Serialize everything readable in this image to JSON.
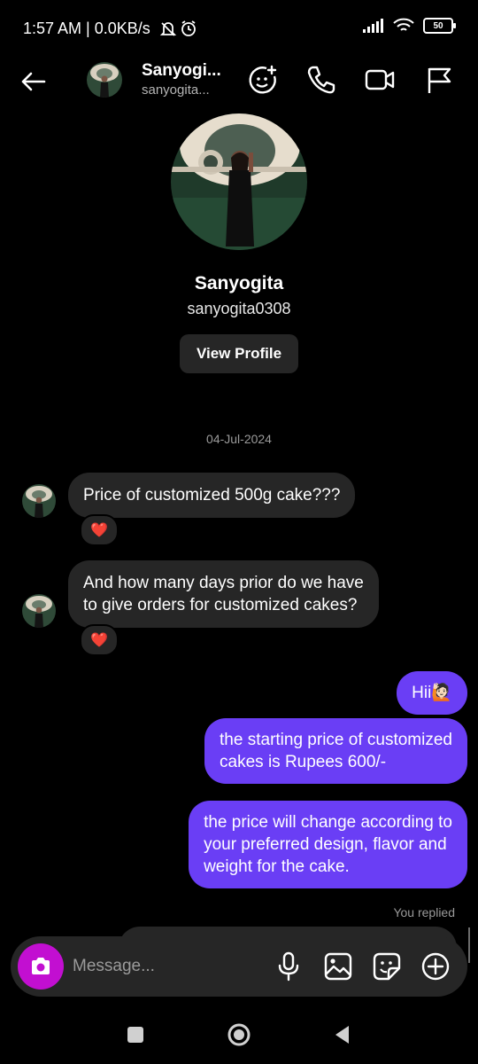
{
  "status_bar": {
    "time": "1:57 AM | 0.0KB/s",
    "battery": "50"
  },
  "header": {
    "name": "Sanyogi...",
    "username": "sanyogita..."
  },
  "profile": {
    "name": "Sanyogita",
    "username": "sanyogita0308",
    "view_profile_label": "View Profile"
  },
  "conversation": {
    "date": "04-Jul-2024",
    "incoming": [
      {
        "text": "Price of customized 500g cake???",
        "reaction": "❤️"
      },
      {
        "line1": "And how many days prior do we have",
        "line2": "to give orders for customized cakes?",
        "reaction": "❤️"
      }
    ],
    "outgoing": [
      {
        "text": "Hii🙋🏻"
      },
      {
        "line1": "the starting price of customized",
        "line2": "cakes is Rupees 600/-"
      },
      {
        "line1": "the price will change according to",
        "line2": "your preferred design, flavor and",
        "line3": "weight for the cake."
      }
    ],
    "you_replied": "You replied"
  },
  "composer": {
    "placeholder": "Message..."
  },
  "colors": {
    "background": "#000000",
    "incoming_bubble": "#262626",
    "outgoing_bubble": "#6a3ef5",
    "camera_button": "#c20fd1"
  },
  "icons": {
    "back": "arrow-left-icon",
    "add_people": "emoji-plus-icon",
    "call": "phone-icon",
    "video": "video-icon",
    "report": "flag-icon",
    "camera": "camera-icon",
    "mic": "microphone-icon",
    "gallery": "image-icon",
    "sticker": "sticker-icon",
    "more": "plus-circle-icon"
  }
}
